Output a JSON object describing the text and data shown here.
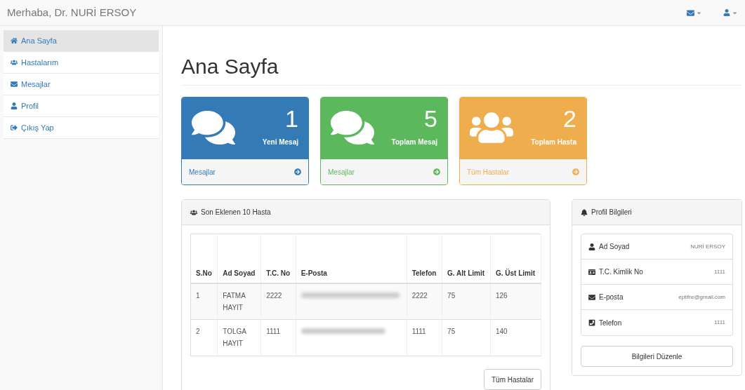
{
  "navbar": {
    "greeting": "Merhaba, Dr. NURİ ERSOY"
  },
  "sidebar": {
    "items": [
      {
        "label": "Ana Sayfa",
        "selected": true
      },
      {
        "label": "Hastalarım",
        "selected": false
      },
      {
        "label": "Mesajlar",
        "selected": false
      },
      {
        "label": "Profil",
        "selected": false
      },
      {
        "label": "Çıkış Yap",
        "selected": false
      }
    ]
  },
  "page_title": "Ana Sayfa",
  "tiles": [
    {
      "kind": "primary",
      "count": "1",
      "caption": "Yeni Mesaj",
      "link": "Mesajlar"
    },
    {
      "kind": "success",
      "count": "5",
      "caption": "Toplam Mesaj",
      "link": "Mesajlar"
    },
    {
      "kind": "warning",
      "count": "2",
      "caption": "Toplam Hasta",
      "link": "Tüm Hastalar"
    }
  ],
  "patients_panel": {
    "title": "Son Eklenen 10 Hasta",
    "columns": [
      "S.No",
      "Ad Soyad",
      "T.C. No",
      "E-Posta",
      "Telefon",
      "G. Alt Limit",
      "G. Üst Limit"
    ],
    "rows": [
      {
        "no": "1",
        "name": "FATMA HAYIT",
        "tc": "2222",
        "phone": "2222",
        "low": "75",
        "high": "126"
      },
      {
        "no": "2",
        "name": "TOLGA HAYIT",
        "tc": "1111",
        "phone": "1111",
        "low": "75",
        "high": "140"
      }
    ],
    "button": "Tüm Hastalar"
  },
  "profile_panel": {
    "title": "Profil Bilgileri",
    "rows": [
      {
        "label": "Ad Soyad",
        "value": "NURİ ERSOY"
      },
      {
        "label": "T.C. Kimlik No",
        "value": "1111"
      },
      {
        "label": "E-posta",
        "value": "eptifre@gmail.com"
      },
      {
        "label": "Telefon",
        "value": "1111"
      }
    ],
    "button": "Bilgileri Düzenle"
  }
}
